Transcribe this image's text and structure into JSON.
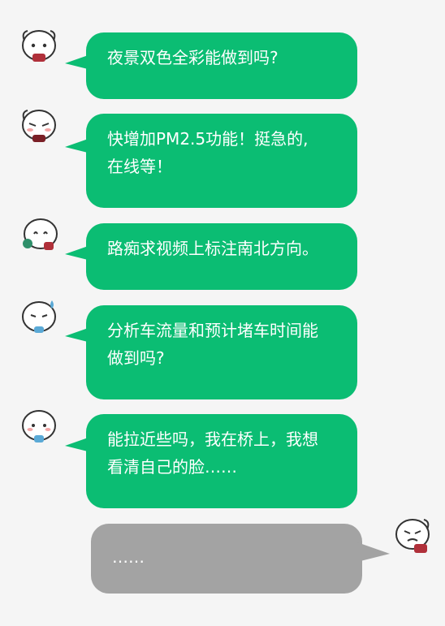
{
  "messages": [
    {
      "side": "left",
      "lines": [
        "夜景双色全彩能做到吗?"
      ]
    },
    {
      "side": "left",
      "lines": [
        "快增加PM2.5功能！挺急的,",
        "在线等！"
      ]
    },
    {
      "side": "left",
      "lines": [
        "路痴求视频上标注南北方向。"
      ]
    },
    {
      "side": "left",
      "lines": [
        "分析车流量和预计堵车时间能",
        "做到吗?"
      ]
    },
    {
      "side": "left",
      "lines": [
        "能拉近些吗，我在桥上，我想",
        "看清自己的脸……"
      ]
    },
    {
      "side": "right",
      "lines": [
        "……"
      ]
    }
  ],
  "colors": {
    "green_bubble": "#0bbd73",
    "gray_bubble": "#a3a3a3",
    "background": "#f5f5f5"
  },
  "icons": [
    "cartoon-avatar-icon"
  ]
}
